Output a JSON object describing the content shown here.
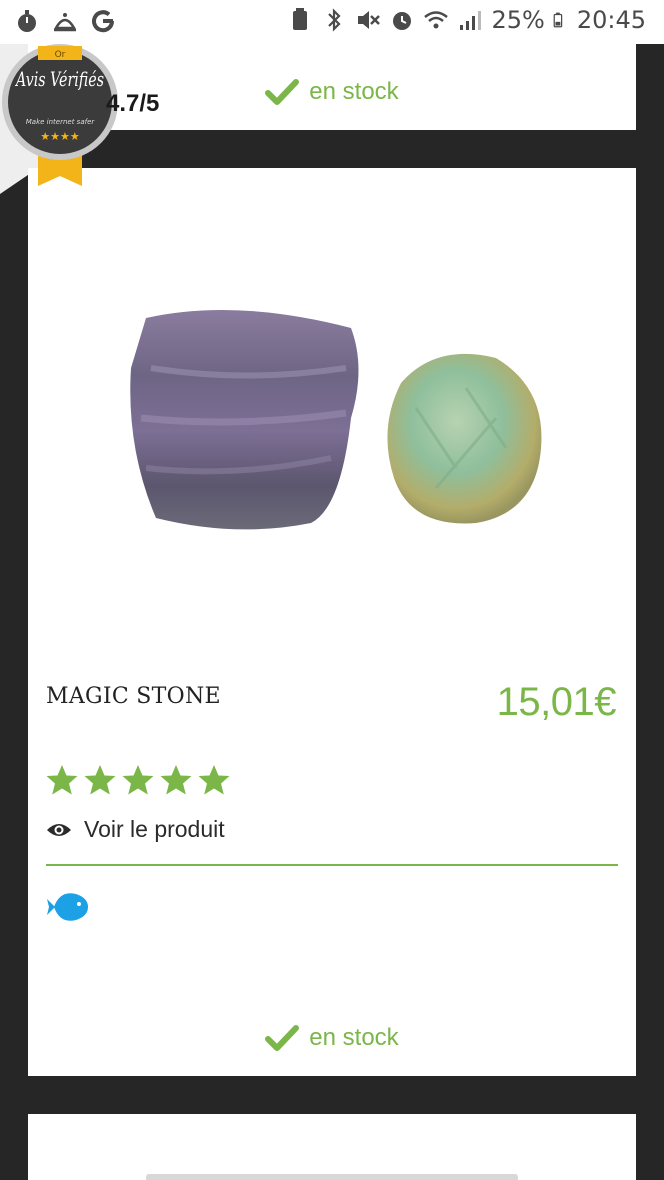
{
  "status_bar": {
    "battery_percent": "25%",
    "time": "20:45",
    "left_icons": [
      "stopwatch-icon",
      "bell-icon",
      "google-icon"
    ],
    "right_icons": [
      "lock-icon",
      "bluetooth-icon",
      "mute-icon",
      "alarm-icon",
      "wifi-icon",
      "signal-icon",
      "battery-icon"
    ]
  },
  "badge": {
    "rating": "4.7/5",
    "logo_text": "Avis Vérifiés",
    "logo_subtext": "Make internet safer",
    "ribbon_text": "Or"
  },
  "top_card": {
    "stock_label": "en stock"
  },
  "product": {
    "name": "MAGIC STONE",
    "price": "15,01€",
    "rating_stars": 5,
    "view_label": "Voir le produit",
    "stock_label": "en stock"
  },
  "colors": {
    "accent": "#7ab648",
    "background": "#262626",
    "fish_blue": "#1ca0e6"
  }
}
